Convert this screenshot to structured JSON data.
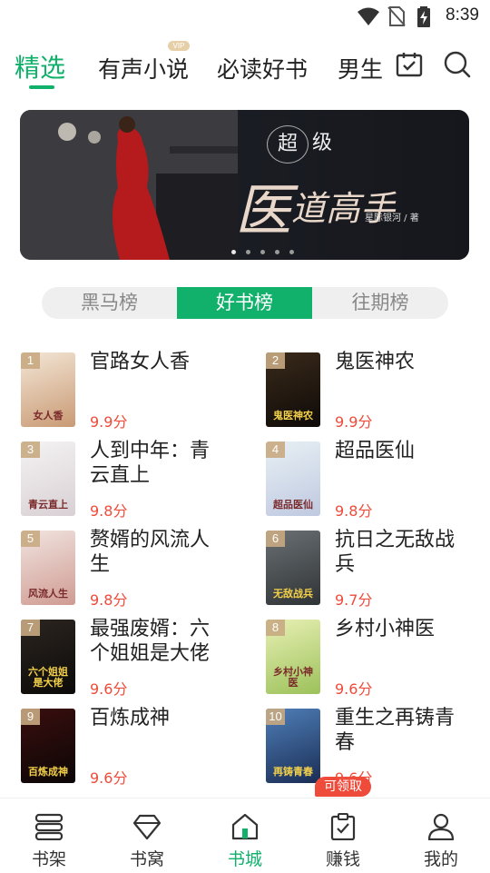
{
  "status_bar": {
    "time": "8:39"
  },
  "top_tabs": [
    {
      "label": "精选",
      "active": true
    },
    {
      "label": "有声小说",
      "badge": "VIP"
    },
    {
      "label": "必读好书"
    },
    {
      "label": "男生"
    }
  ],
  "top_icons": [
    "calendar-check-icon",
    "search-icon"
  ],
  "banner": {
    "title_small_1": "超",
    "title_small_2": "级",
    "title_big_1": "医",
    "title_big_2": "道高手",
    "author": "星际银河 / 著",
    "page_count": 5,
    "current_page": 1
  },
  "ranking_tabs": [
    {
      "label": "黑马榜"
    },
    {
      "label": "好书榜",
      "active": true
    },
    {
      "label": "往期榜"
    }
  ],
  "books": [
    {
      "rank": "1",
      "title": "官路女人香",
      "score": "9.9分",
      "cover_text": "女人香",
      "cover_colors": [
        "#f3e6d6",
        "#c99a74"
      ]
    },
    {
      "rank": "2",
      "title": "鬼医神农",
      "score": "9.9分",
      "cover_text": "鬼医神农",
      "cover_colors": [
        "#3a2a1a",
        "#0e0a08"
      ]
    },
    {
      "rank": "3",
      "title": "人到中年：青云直上",
      "score": "9.8分",
      "cover_text": "青云直上",
      "cover_colors": [
        "#f5f3f3",
        "#d8d0d4"
      ]
    },
    {
      "rank": "4",
      "title": "超品医仙",
      "score": "9.8分",
      "cover_text": "超品医仙",
      "cover_colors": [
        "#e8f0f4",
        "#bfc9e0"
      ]
    },
    {
      "rank": "5",
      "title": "赘婿的风流人生",
      "score": "9.8分",
      "cover_text": "风流人生",
      "cover_colors": [
        "#f1e4e0",
        "#cf9b92"
      ]
    },
    {
      "rank": "6",
      "title": "抗日之无敌战兵",
      "score": "9.7分",
      "cover_text": "无敌战兵",
      "cover_colors": [
        "#6a7073",
        "#2f3336"
      ]
    },
    {
      "rank": "7",
      "title": "最强废婿：六个姐姐是大佬",
      "score": "9.6分",
      "cover_text": "六个姐姐是大佬",
      "cover_colors": [
        "#2b2520",
        "#0c0a08"
      ]
    },
    {
      "rank": "8",
      "title": "乡村小神医",
      "score": "9.6分",
      "cover_text": "乡村小神医",
      "cover_colors": [
        "#e8f0b4",
        "#9cc15a"
      ]
    },
    {
      "rank": "9",
      "title": "百炼成神",
      "score": "9.6分",
      "cover_text": "百炼成神",
      "cover_colors": [
        "#3a0e0e",
        "#0b0606"
      ]
    },
    {
      "rank": "10",
      "title": "重生之再铸青春",
      "score": "9.6分",
      "cover_text": "再铸青春",
      "cover_colors": [
        "#4f7fb8",
        "#1a2d55"
      ]
    }
  ],
  "claim_badge": "可领取",
  "bottom_nav": [
    {
      "label": "书架",
      "icon": "bookshelf-icon"
    },
    {
      "label": "书窝",
      "icon": "gem-icon"
    },
    {
      "label": "书城",
      "icon": "home-icon",
      "active": true
    },
    {
      "label": "赚钱",
      "icon": "clipboard-check-icon"
    },
    {
      "label": "我的",
      "icon": "user-icon"
    }
  ],
  "colors": {
    "accent": "#11b16c",
    "score": "#ef4b3a",
    "claim": "#ef4b3a"
  }
}
